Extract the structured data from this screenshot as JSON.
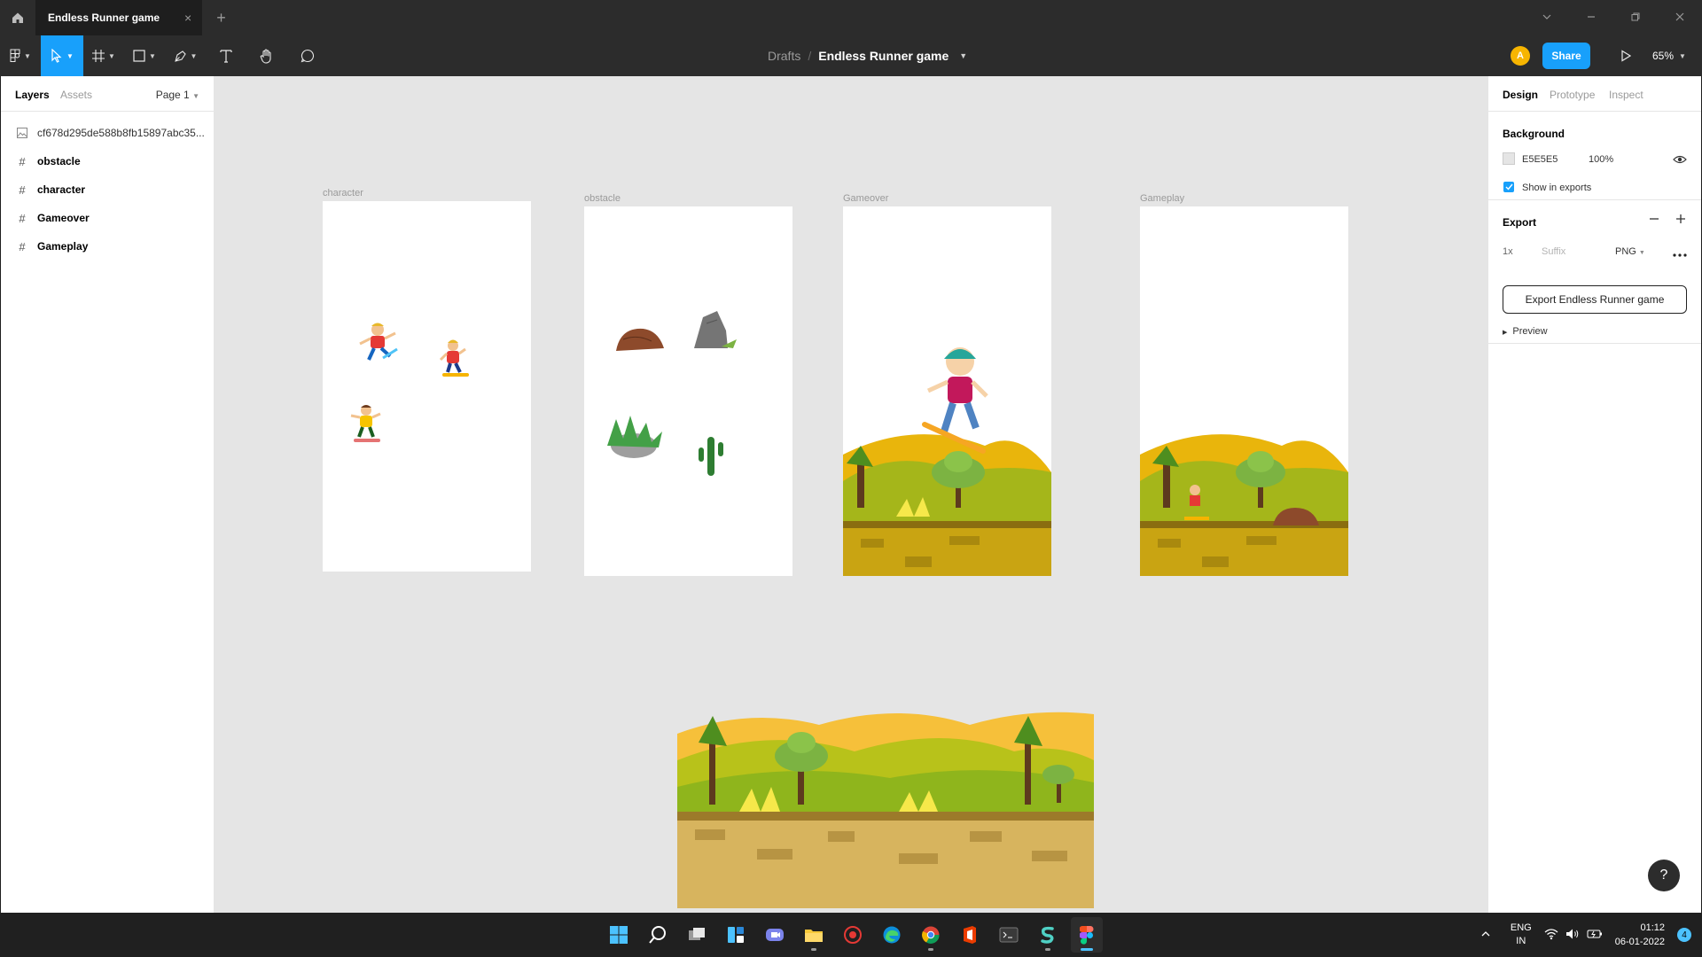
{
  "titlebar": {
    "tab_title": "Endless Runner game",
    "tab_close": "×",
    "new_tab": "+"
  },
  "toolbar": {
    "breadcrumb_root": "Drafts",
    "breadcrumb_sep": "/",
    "file_name": "Endless Runner game",
    "avatar_initial": "A",
    "share_label": "Share",
    "zoom_level": "65%"
  },
  "left_panel": {
    "tab_layers": "Layers",
    "tab_assets": "Assets",
    "page_label": "Page 1",
    "layers": [
      {
        "name": "cf678d295de588b8fb15897abc35...",
        "kind": "image"
      },
      {
        "name": "obstacle",
        "kind": "frame"
      },
      {
        "name": "character",
        "kind": "frame"
      },
      {
        "name": "Gameover",
        "kind": "frame"
      },
      {
        "name": "Gameplay",
        "kind": "frame"
      }
    ]
  },
  "canvas": {
    "background_color": "#E5E5E5",
    "frames": [
      {
        "label": "character"
      },
      {
        "label": "obstacle"
      },
      {
        "label": "Gameover"
      },
      {
        "label": "Gameplay"
      }
    ]
  },
  "right_panel": {
    "tab_design": "Design",
    "tab_prototype": "Prototype",
    "tab_inspect": "Inspect",
    "background_title": "Background",
    "background_hex": "E5E5E5",
    "background_opacity": "100%",
    "show_in_exports_label": "Show in exports",
    "show_in_exports_checked": true,
    "export_title": "Export",
    "export_scale": "1x",
    "export_suffix_placeholder": "Suffix",
    "export_format": "PNG",
    "export_button_label": "Export Endless Runner game",
    "preview_label": "Preview",
    "help_label": "?"
  },
  "taskbar": {
    "lang_line1": "ENG",
    "lang_line2": "IN",
    "time": "01:12",
    "date": "06-01-2022",
    "notification_count": "4",
    "icons": [
      "windows-start-icon",
      "search-icon",
      "task-view-icon",
      "widgets-icon",
      "teams-chat-icon",
      "file-explorer-icon",
      "record-icon",
      "edge-icon",
      "chrome-icon",
      "office-icon",
      "terminal-icon",
      "app-s-icon",
      "figma-icon"
    ]
  },
  "colors": {
    "accent": "#18A0FB",
    "dark_chrome": "#2C2C2C",
    "canvas": "#E5E5E5"
  }
}
